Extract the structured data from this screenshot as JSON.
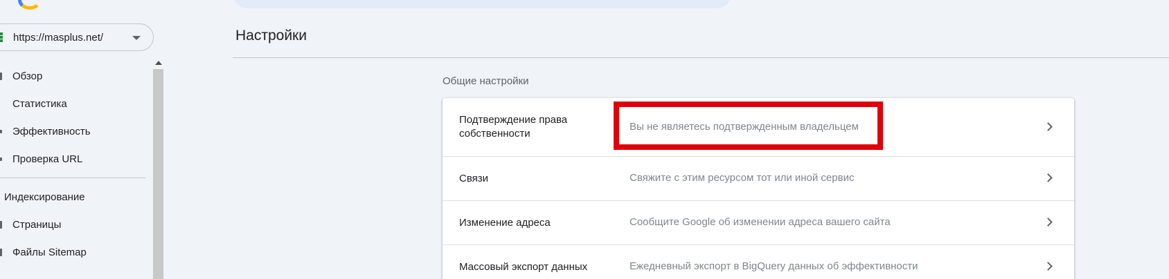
{
  "sidebar": {
    "property_url": "https://masplus.net/",
    "items": [
      {
        "label": "Обзор",
        "icon": "home-icon"
      },
      {
        "label": "Статистика",
        "icon": "insights-icon"
      },
      {
        "label": "Эффективность",
        "icon": "trending-icon"
      },
      {
        "label": "Проверка URL",
        "icon": "search-icon"
      }
    ],
    "section_indexing": "Индексирование",
    "indexing_items": [
      {
        "label": "Страницы",
        "icon": "pages-icon"
      },
      {
        "label": "Файлы Sitemap",
        "icon": "sitemap-icon"
      }
    ]
  },
  "main": {
    "title": "Настройки",
    "section_label": "Общие настройки",
    "rows": [
      {
        "title": "Подтверждение права собственности",
        "desc": "Вы не являетесь подтвержденным владельцем"
      },
      {
        "title": "Связи",
        "desc": "Свяжите с этим ресурсом тот или иной сервис"
      },
      {
        "title": "Изменение адреса",
        "desc": "Сообщите Google об изменении адреса вашего сайта"
      },
      {
        "title": "Массовый экспорт данных",
        "desc": "Ежедневный экспорт в BigQuery данных об эффективности"
      }
    ]
  },
  "colors": {
    "background": "#f0f3f8",
    "highlight": "#e0000a",
    "card": "#ffffff"
  }
}
